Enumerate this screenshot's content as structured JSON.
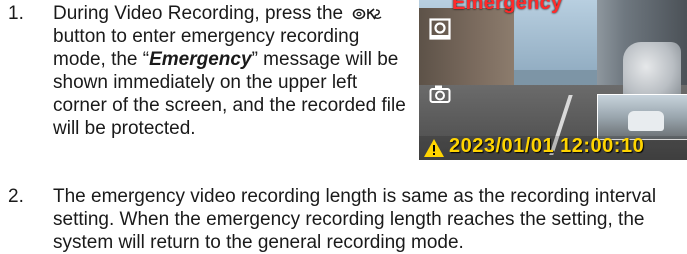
{
  "items": [
    {
      "number": "1.",
      "text_before": "During Video Recording, press the",
      "ok_icon": "ok-button-icon",
      "text_after_line1": "button to enter emergency recording mode, the “",
      "emphasis": "Emergency",
      "text_after": "” message will be shown immediately on the upper left corner of the screen, and the recorded file will be protected."
    },
    {
      "number": "2.",
      "text": "The emergency video recording length is same as the recording interval setting. When the emergency recording length reaches the setting, the system will return to the general recording mode."
    }
  ],
  "screen": {
    "emergency_label": "Emergency",
    "timestamp": "2023/01/01 12:00:10",
    "icons": [
      "recording-icon",
      "camera-icon",
      "warning-icon"
    ],
    "colors": {
      "emergency": "#ff2a2a",
      "timestamp": "#ffd400",
      "warning": "#ffd400"
    }
  }
}
